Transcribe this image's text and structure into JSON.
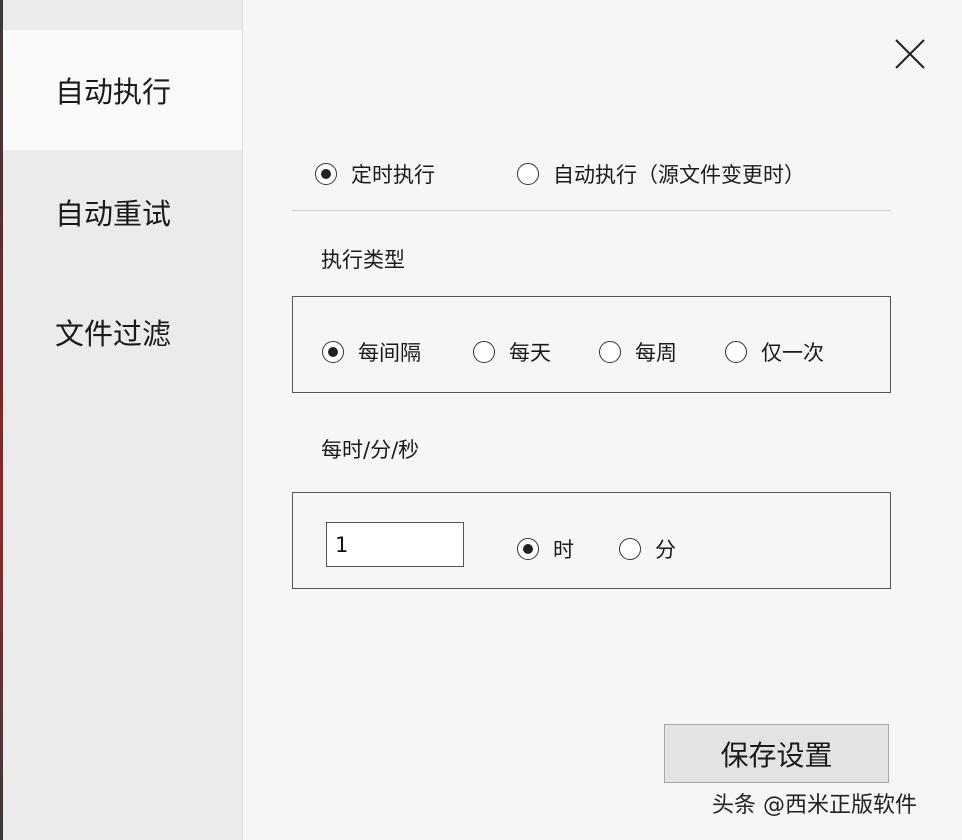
{
  "sidebar": {
    "items": [
      {
        "label": "自动执行",
        "active": true
      },
      {
        "label": "自动重试",
        "active": false
      },
      {
        "label": "文件过滤",
        "active": false
      }
    ]
  },
  "mode": {
    "timed_label": "定时执行",
    "auto_label": "自动执行（源文件变更时）",
    "selected": "timed"
  },
  "exec_type": {
    "label": "执行类型",
    "options": [
      "每间隔",
      "每天",
      "每周",
      "仅一次"
    ],
    "selected": 0
  },
  "interval": {
    "label": "每时/分/秒",
    "value": "1",
    "units": [
      "时",
      "分"
    ],
    "selected_unit": 0
  },
  "save_label": "保存设置",
  "watermark": "头条 @西米正版软件"
}
